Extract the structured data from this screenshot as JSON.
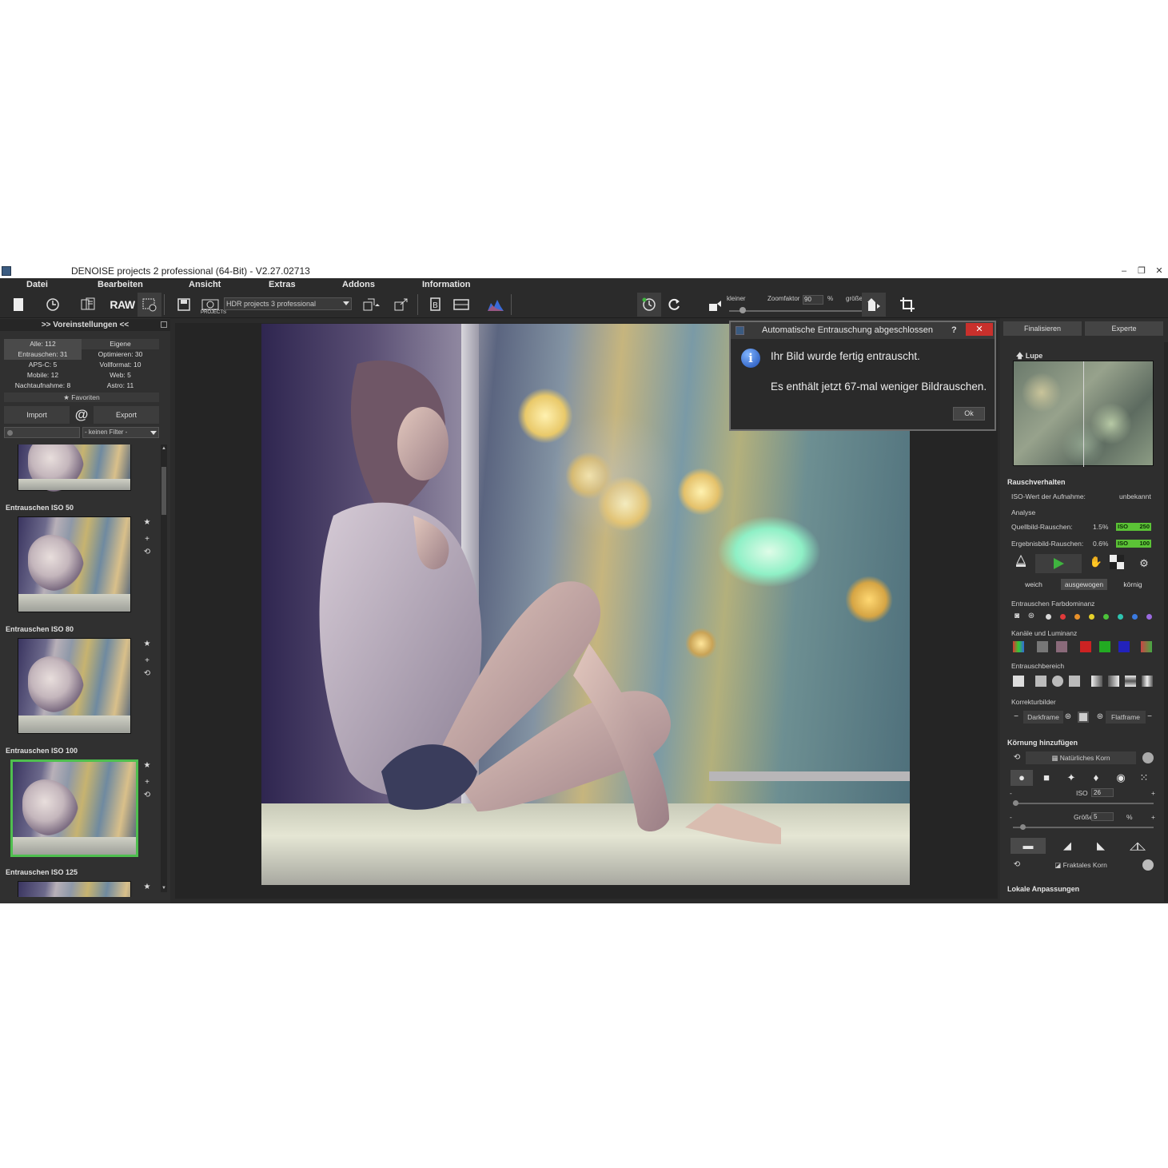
{
  "window": {
    "title": "DENOISE projects 2 professional (64-Bit) - V2.27.02713",
    "controls": [
      "–",
      "❐",
      "✕"
    ]
  },
  "menu": [
    "Datei",
    "Bearbeiten",
    "Ansicht",
    "Extras",
    "Addons",
    "Information"
  ],
  "toolbar": {
    "raw_label": "RAW",
    "projects_label": "PROJECTS",
    "combo_value": "HDR projects 3 professional",
    "zoom": {
      "smaller_label": "kleiner",
      "factor_label": "Zoomfaktor",
      "value": "90",
      "unit": "%",
      "larger_label": "größer"
    }
  },
  "left": {
    "header": ">> Voreinstellungen <<",
    "stats": [
      [
        "Alle: 112",
        "Eigene"
      ],
      [
        "Entrauschen: 31",
        "Optimieren: 30"
      ],
      [
        "APS-C: 5",
        "Vollformat: 10"
      ],
      [
        "Mobile: 12",
        "Web: 5"
      ],
      [
        "Nachtaufnahme: 8",
        "Astro: 11"
      ]
    ],
    "favorites": "Favoriten",
    "import": "Import",
    "at": "@",
    "export": "Export",
    "filter": "- keinen Filter -",
    "presets": [
      "Entrauschen ISO 50",
      "Entrauschen ISO 80",
      "Entrauschen ISO 100",
      "Entrauschen ISO 125"
    ],
    "selected_preset": "Entrauschen ISO 100"
  },
  "dialog": {
    "title": "Automatische Entrauschung abgeschlossen",
    "help": "?",
    "close": "✕",
    "line1": "Ihr Bild wurde fertig entrauscht.",
    "line2": "Es enthält jetzt 67-mal weniger Bildrauschen.",
    "ok": "Ok"
  },
  "right": {
    "tabs": [
      "Finalisieren",
      "Experte"
    ],
    "lupe": "Lupe",
    "noise_section": "Rauschverhalten",
    "iso_label": "ISO-Wert der Aufnahme:",
    "iso_value": "unbekannt",
    "analyse": "Analyse",
    "source_label": "Quellbild-Rauschen:",
    "source_pct": "1.5%",
    "source_iso_tag": "ISO",
    "source_iso": "250",
    "result_label": "Ergebnisbild-Rauschen:",
    "result_pct": "0.6%",
    "result_iso_tag": "ISO",
    "result_iso": "100",
    "modes": [
      "weich",
      "ausgewogen",
      "körnig"
    ],
    "active_mode": "ausgewogen",
    "color_dominance": "Entrauschen Farbdominanz",
    "channels": "Kanäle und Luminanz",
    "range": "Entrauschbereich",
    "correction": "Korrekturbilder",
    "darkframe": "Darkframe",
    "flatframe": "Flatframe",
    "grain_section": "Körnung hinzufügen",
    "natural_grain": "Natürliches Korn",
    "iso_slider_label": "ISO",
    "iso_slider_value": "26",
    "size_label": "Größe",
    "size_value": "5",
    "size_unit": "%",
    "fractal_grain": "Fraktales Korn",
    "local_section": "Lokale Anpassungen",
    "colors": [
      "#d8d8d8",
      "#e03a3a",
      "#e8902a",
      "#e6d12a",
      "#4cc23a",
      "#2ec4b0",
      "#3a7ae0",
      "#9a6ae0"
    ]
  }
}
